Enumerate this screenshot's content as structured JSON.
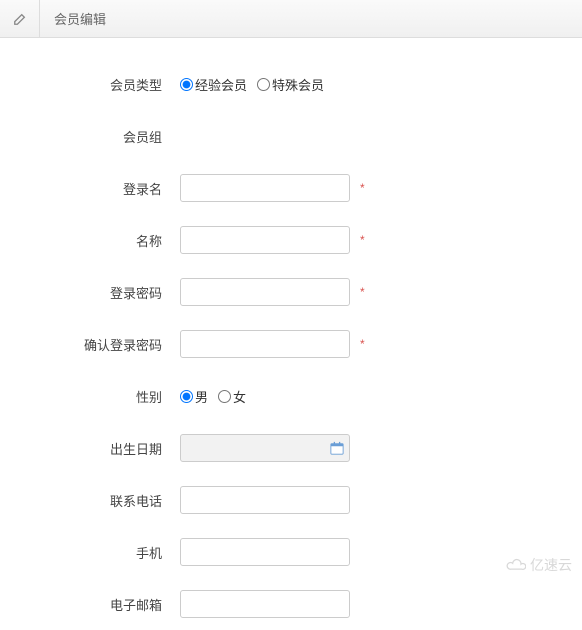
{
  "header": {
    "title": "会员编辑"
  },
  "form": {
    "memberType": {
      "label": "会员类型",
      "options": [
        "经验会员",
        "特殊会员"
      ],
      "selected": "经验会员"
    },
    "memberGroup": {
      "label": "会员组"
    },
    "loginName": {
      "label": "登录名",
      "value": "",
      "required": true
    },
    "name": {
      "label": "名称",
      "value": "",
      "required": true
    },
    "password": {
      "label": "登录密码",
      "value": "",
      "required": true
    },
    "confirmPassword": {
      "label": "确认登录密码",
      "value": "",
      "required": true
    },
    "gender": {
      "label": "性别",
      "options": [
        "男",
        "女"
      ],
      "selected": "男"
    },
    "birthDate": {
      "label": "出生日期",
      "value": ""
    },
    "phone": {
      "label": "联系电话",
      "value": ""
    },
    "mobile": {
      "label": "手机",
      "value": ""
    },
    "email": {
      "label": "电子邮箱",
      "value": ""
    }
  },
  "requiredMark": "*",
  "watermark": "亿速云"
}
